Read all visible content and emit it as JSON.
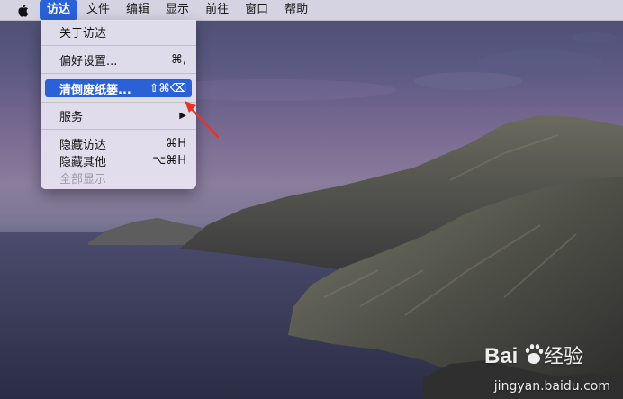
{
  "menubar": {
    "apple_icon": "apple-logo",
    "items": [
      {
        "label": "访达",
        "active": true
      },
      {
        "label": "文件"
      },
      {
        "label": "编辑"
      },
      {
        "label": "显示"
      },
      {
        "label": "前往"
      },
      {
        "label": "窗口"
      },
      {
        "label": "帮助"
      }
    ]
  },
  "dropdown": {
    "items": [
      {
        "label": "关于访达",
        "shortcut": ""
      },
      {
        "label": "偏好设置...",
        "shortcut": "⌘,"
      },
      {
        "label": "清倒废纸篓...",
        "shortcut": "⇧⌘⌫",
        "highlighted": true
      },
      {
        "label": "服务",
        "shortcut": "▶"
      },
      {
        "label": "隐藏访达",
        "shortcut": "⌘H"
      },
      {
        "label": "隐藏其他",
        "shortcut": "⌥⌘H"
      },
      {
        "label": "全部显示",
        "shortcut": "",
        "disabled": true
      }
    ]
  },
  "colors": {
    "accent": "#2a61d6",
    "annotation_arrow": "#e8332a"
  },
  "watermark": {
    "brand": "Baidu经验",
    "url": "jingyan.baidu.com"
  }
}
